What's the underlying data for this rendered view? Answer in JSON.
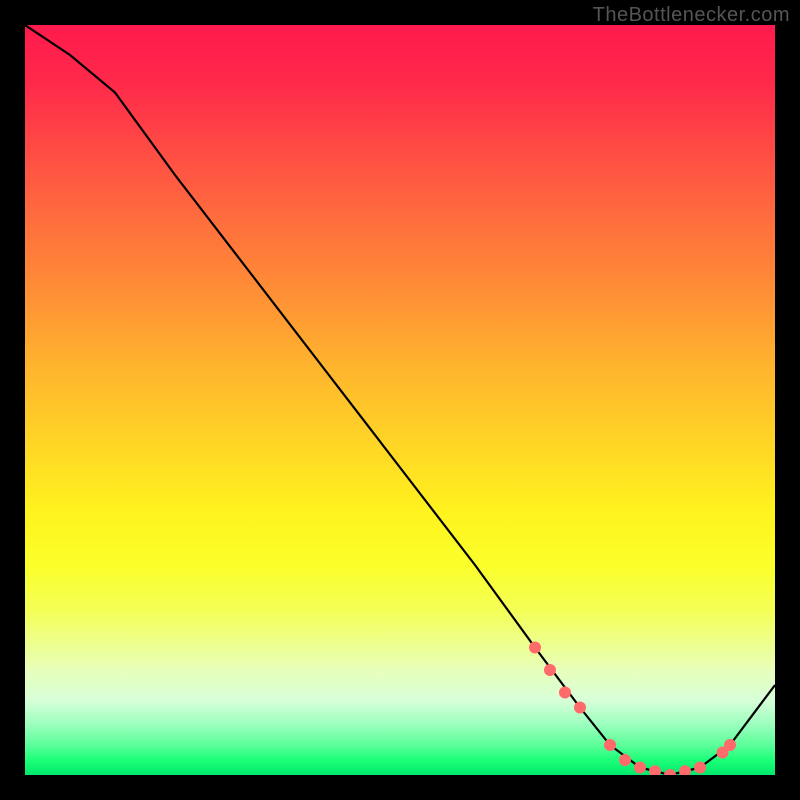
{
  "watermark": "TheBottlenecker.com",
  "chart_data": {
    "type": "line",
    "title": "",
    "xlabel": "",
    "ylabel": "",
    "xlim": [
      0,
      100
    ],
    "ylim": [
      0,
      100
    ],
    "series": [
      {
        "name": "bottleneck-curve",
        "x": [
          0,
          6,
          12,
          20,
          30,
          40,
          50,
          60,
          68,
          74,
          78,
          82,
          86,
          90,
          94,
          100
        ],
        "y": [
          100,
          96,
          91,
          80,
          67,
          54,
          41,
          28,
          17,
          9,
          4,
          1,
          0,
          1,
          4,
          12
        ]
      }
    ],
    "markers": {
      "name": "highlight-points",
      "color": "#ff6b6b",
      "x": [
        68,
        70,
        72,
        74,
        78,
        80,
        82,
        84,
        86,
        88,
        90,
        93,
        94
      ],
      "y": [
        17,
        14,
        11,
        9,
        4,
        2,
        1,
        0.5,
        0,
        0.5,
        1,
        3,
        4
      ]
    },
    "gradient_stops": [
      {
        "pct": 0,
        "color": "#ff1a4d"
      },
      {
        "pct": 50,
        "color": "#ffd326"
      },
      {
        "pct": 100,
        "color": "#00e86c"
      }
    ]
  }
}
